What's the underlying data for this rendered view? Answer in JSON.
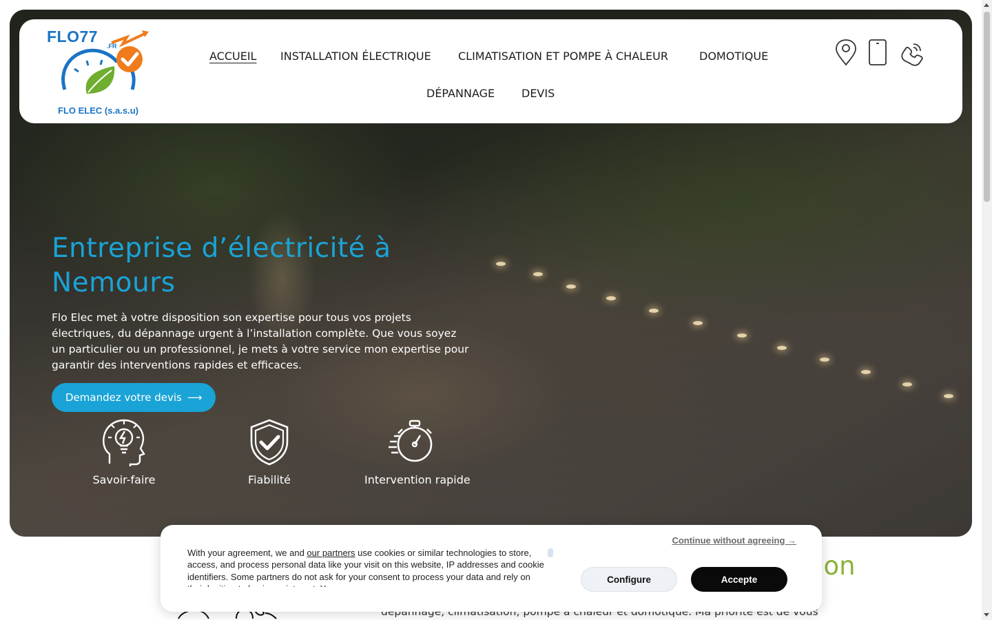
{
  "header": {
    "logo": {
      "brand": "FLO77",
      "domain_suffix": ".FR",
      "caption": "FLO ELEC (s.a.s.u)"
    },
    "nav": [
      {
        "label": "ACCUEIL",
        "active": true
      },
      {
        "label": "INSTALLATION ÉLECTRIQUE",
        "active": false
      },
      {
        "label": "CLIMATISATION ET POMPE À CHALEUR",
        "active": false
      },
      {
        "label": "DOMOTIQUE",
        "active": false
      },
      {
        "label": "DÉPANNAGE",
        "active": false
      },
      {
        "label": "DEVIS",
        "active": false
      }
    ],
    "contact_icons": [
      "map-pin-icon",
      "mobile-phone-icon",
      "telephone-icon"
    ]
  },
  "hero": {
    "title": "Entreprise d’électricité à Nemours",
    "text": "Flo Elec met à votre disposition son expertise pour tous vos projets électriques, du dépannage urgent à l’installation complète. Que vous soyez un particulier ou un professionnel, je mets à votre service mon expertise pour garantir des interventions rapides et efficaces.",
    "cta_label": "Demandez votre devis",
    "cta_arrow": "⟶",
    "features": [
      {
        "label": "Savoir-faire",
        "icon": "head-lightbulb-icon"
      },
      {
        "label": "Fiabilité",
        "icon": "shield-check-icon"
      },
      {
        "label": "Intervention rapide",
        "icon": "stopwatch-icon"
      }
    ]
  },
  "below": {
    "heading_fragment": "ation",
    "text_fragment": "dépannage, climatisation, pompe à chaleur et domotique. Ma priorité est de vous"
  },
  "cookie_banner": {
    "text_before_link": "With your agreement, we and ",
    "link_label": "our partners",
    "text_after_link": " use cookies or similar technologies to store, access, and process personal data like your visit on this website, IP addresses and cookie identifiers. Some partners do not ask for your consent to process your data and rely on their legitimate business interest. You can",
    "continue_label": "Continue without agreeing →",
    "configure_label": "Configure",
    "accept_label": "Accepte"
  },
  "colors": {
    "accent_blue": "#1aa3d6",
    "logo_blue": "#1a74c5",
    "logo_green": "#6fae2f",
    "logo_orange": "#f07b1a",
    "section_green": "#8ab33a"
  }
}
